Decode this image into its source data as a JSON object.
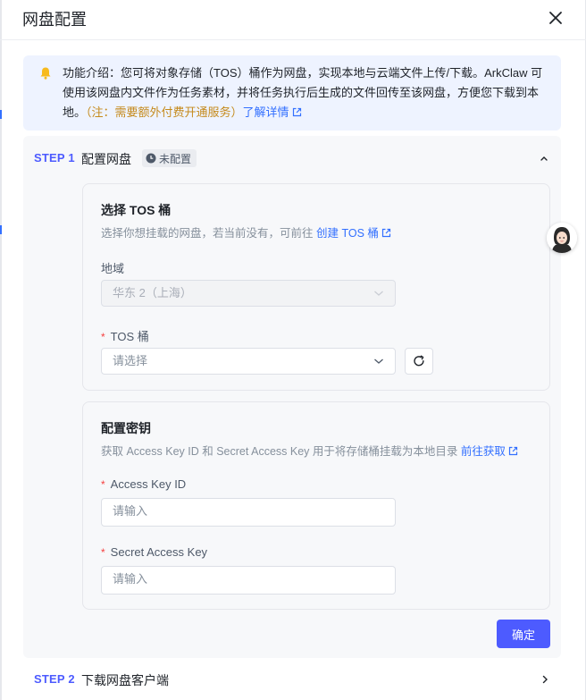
{
  "dialog": {
    "title": "网盘配置"
  },
  "notice": {
    "icon": "bell-icon",
    "text": "功能介绍：您可将对象存储（TOS）桶作为网盘，实现本地与云端文件上传/下载。ArkClaw 可使用该网盘内文件作为任务素材，并将任务执行后生成的文件回传至该网盘，方便您下载到本地。",
    "note": "（注：需要额外付费开通服务）",
    "link": "了解详情"
  },
  "step1": {
    "num": "STEP 1",
    "title": "配置网盘",
    "badge": "未配置",
    "tos_panel": {
      "title": "选择 TOS 桶",
      "desc": "选择你想挂载的网盘，若当前没有，可前往",
      "desc_link": "创建 TOS 桶",
      "region_label": "地域",
      "region_value": "华东 2（上海）",
      "bucket_label": "TOS 桶",
      "bucket_placeholder": "请选择"
    },
    "key_panel": {
      "title": "配置密钥",
      "desc": "获取 Access Key ID 和 Secret Access Key 用于将存储桶挂载为本地目录",
      "desc_link": "前往获取",
      "ak_label": "Access Key ID",
      "ak_placeholder": "请输入",
      "sk_label": "Secret Access Key",
      "sk_placeholder": "请输入"
    },
    "confirm": "确定"
  },
  "step2": {
    "num": "STEP 2",
    "title": "下载网盘客户端"
  },
  "colors": {
    "accent": "#4d5bff",
    "link": "#3370ff",
    "required": "#f53f3f",
    "note": "#c58a1c"
  }
}
